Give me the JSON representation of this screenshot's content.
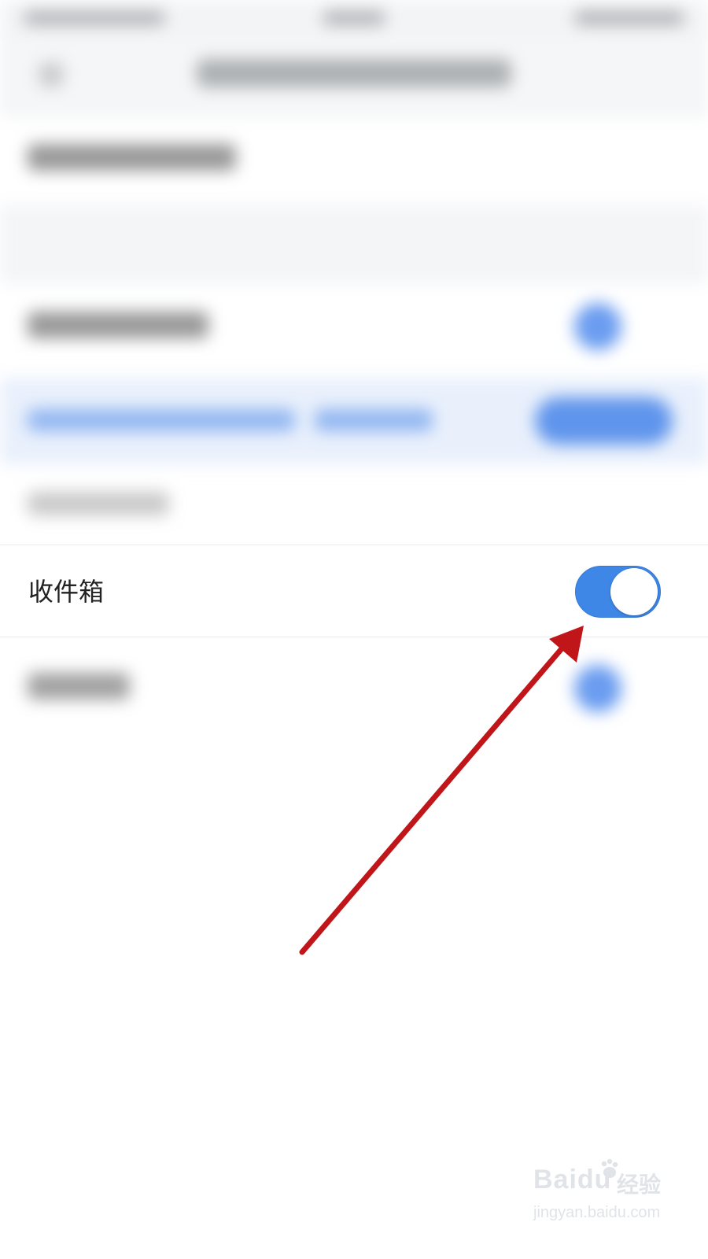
{
  "inbox_row": {
    "label": "收件箱",
    "toggle_on": true
  },
  "colors": {
    "toggle_on": "#3f87e6",
    "toggle_knob": "#ffffff",
    "arrow": "#c0161a",
    "blurred_accent": "#6a9cf0"
  },
  "watermark": {
    "logo_text": "Baidu",
    "cn_text": "经验",
    "url": "jingyan.baidu.com"
  }
}
